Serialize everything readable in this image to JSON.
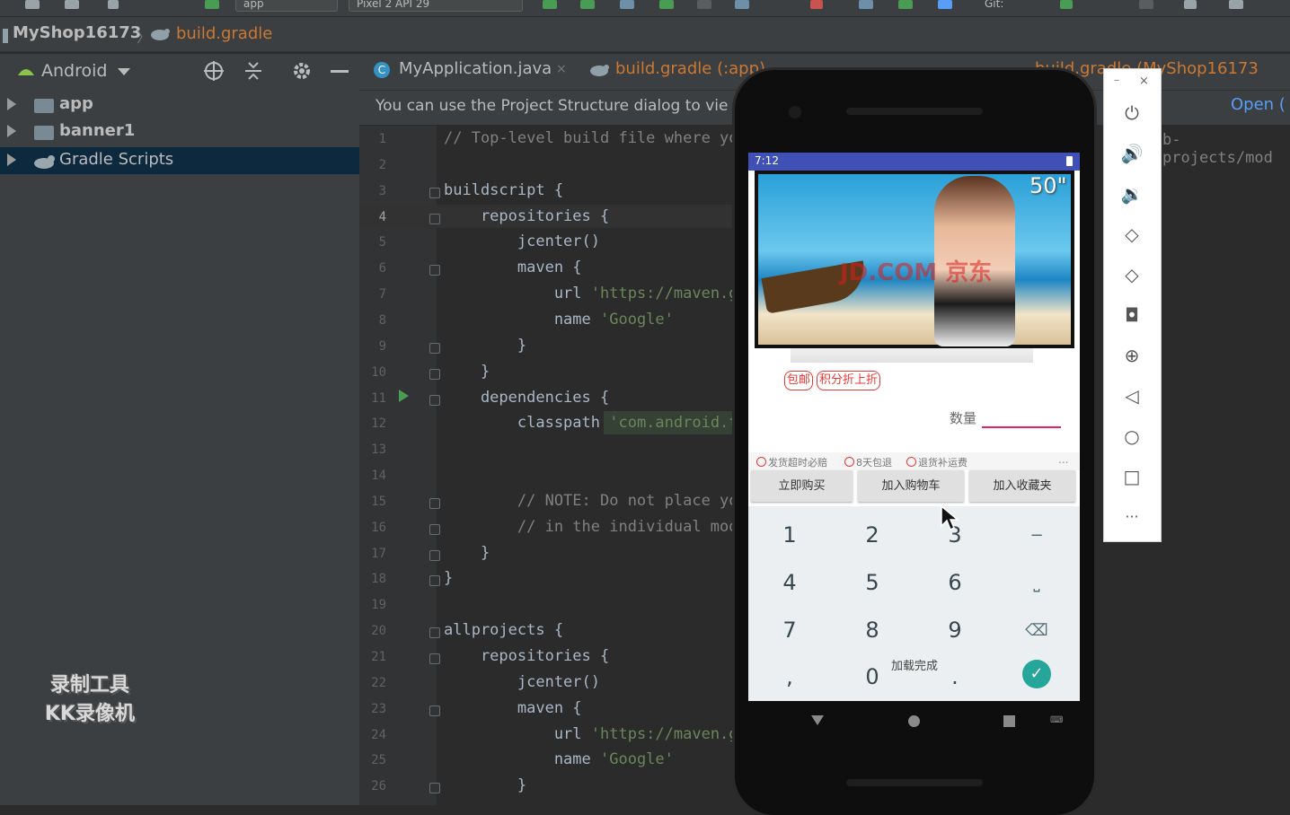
{
  "toolbar": {
    "run_config": "app",
    "device": "Pixel 2 API 29",
    "vcs_label": "Git:"
  },
  "navbar": {
    "project": "MyShop16173",
    "file": "build.gradle"
  },
  "project_panel": {
    "view_mode": "Android",
    "items": [
      {
        "label": "app"
      },
      {
        "label": "banner1"
      },
      {
        "label": "Gradle Scripts"
      }
    ]
  },
  "watermark": {
    "line1": "录制工具",
    "line2": "KK录像机"
  },
  "editor": {
    "tabs": [
      {
        "label": "MyApplication.java"
      },
      {
        "label": "build.gradle (:app)"
      },
      {
        "label": "build.gradle (MyShop16173"
      }
    ],
    "notice": "You can use the Project Structure dialog to vie",
    "notice_action": "Open (",
    "right_fragment": "b-projects/mod",
    "lines": [
      {
        "n": "1",
        "text": "// Top-level build file where yo",
        "cls": "cm"
      },
      {
        "n": "2",
        "text": ""
      },
      {
        "n": "3",
        "text": "buildscript {"
      },
      {
        "n": "4",
        "text": "    repositories {"
      },
      {
        "n": "5",
        "text": "        jcenter()"
      },
      {
        "n": "6",
        "text": "        maven {"
      },
      {
        "n": "7",
        "text": "            url ",
        "str": "'https://maven.g"
      },
      {
        "n": "8",
        "text": "            name ",
        "str": "'Google'"
      },
      {
        "n": "9",
        "text": "        }"
      },
      {
        "n": "10",
        "text": "    }"
      },
      {
        "n": "11",
        "text": "    dependencies {"
      },
      {
        "n": "12",
        "text": "        classpath ",
        "str": "'com.android.t"
      },
      {
        "n": "13",
        "text": ""
      },
      {
        "n": "14",
        "text": ""
      },
      {
        "n": "15",
        "text": "        // NOTE: Do not place yo",
        "cls": "cm"
      },
      {
        "n": "16",
        "text": "        // in the individual mod",
        "cls": "cm"
      },
      {
        "n": "17",
        "text": "    }"
      },
      {
        "n": "18",
        "text": "}"
      },
      {
        "n": "19",
        "text": ""
      },
      {
        "n": "20",
        "text": "allprojects {"
      },
      {
        "n": "21",
        "text": "    repositories {"
      },
      {
        "n": "22",
        "text": "        jcenter()"
      },
      {
        "n": "23",
        "text": "        maven {"
      },
      {
        "n": "24",
        "text": "            url ",
        "str": "'https://maven.g"
      },
      {
        "n": "25",
        "text": "            name ",
        "str": "'Google'"
      },
      {
        "n": "26",
        "text": "        }"
      }
    ]
  },
  "phone": {
    "time": "7:12",
    "banner_size": "50\"",
    "banner_brand": "JD.COM 京东",
    "badges": [
      "包邮",
      "积分折上折"
    ],
    "qty_label": "数量",
    "services": [
      "发货超时必赔",
      "8天包退",
      "退货补运费"
    ],
    "services_more": "...",
    "buttons": [
      "立即购买",
      "加入购物车",
      "加入收藏夹"
    ],
    "toast": "加载完成",
    "keys": [
      [
        "1",
        "2",
        "3",
        "−"
      ],
      [
        "4",
        "5",
        "6",
        "⎵"
      ],
      [
        "7",
        "8",
        "9",
        "⌫"
      ],
      [
        ",",
        "0",
        ".",
        "✓"
      ]
    ]
  },
  "emulator_panel": {
    "minimize": "–",
    "close": "×",
    "more": "···"
  }
}
